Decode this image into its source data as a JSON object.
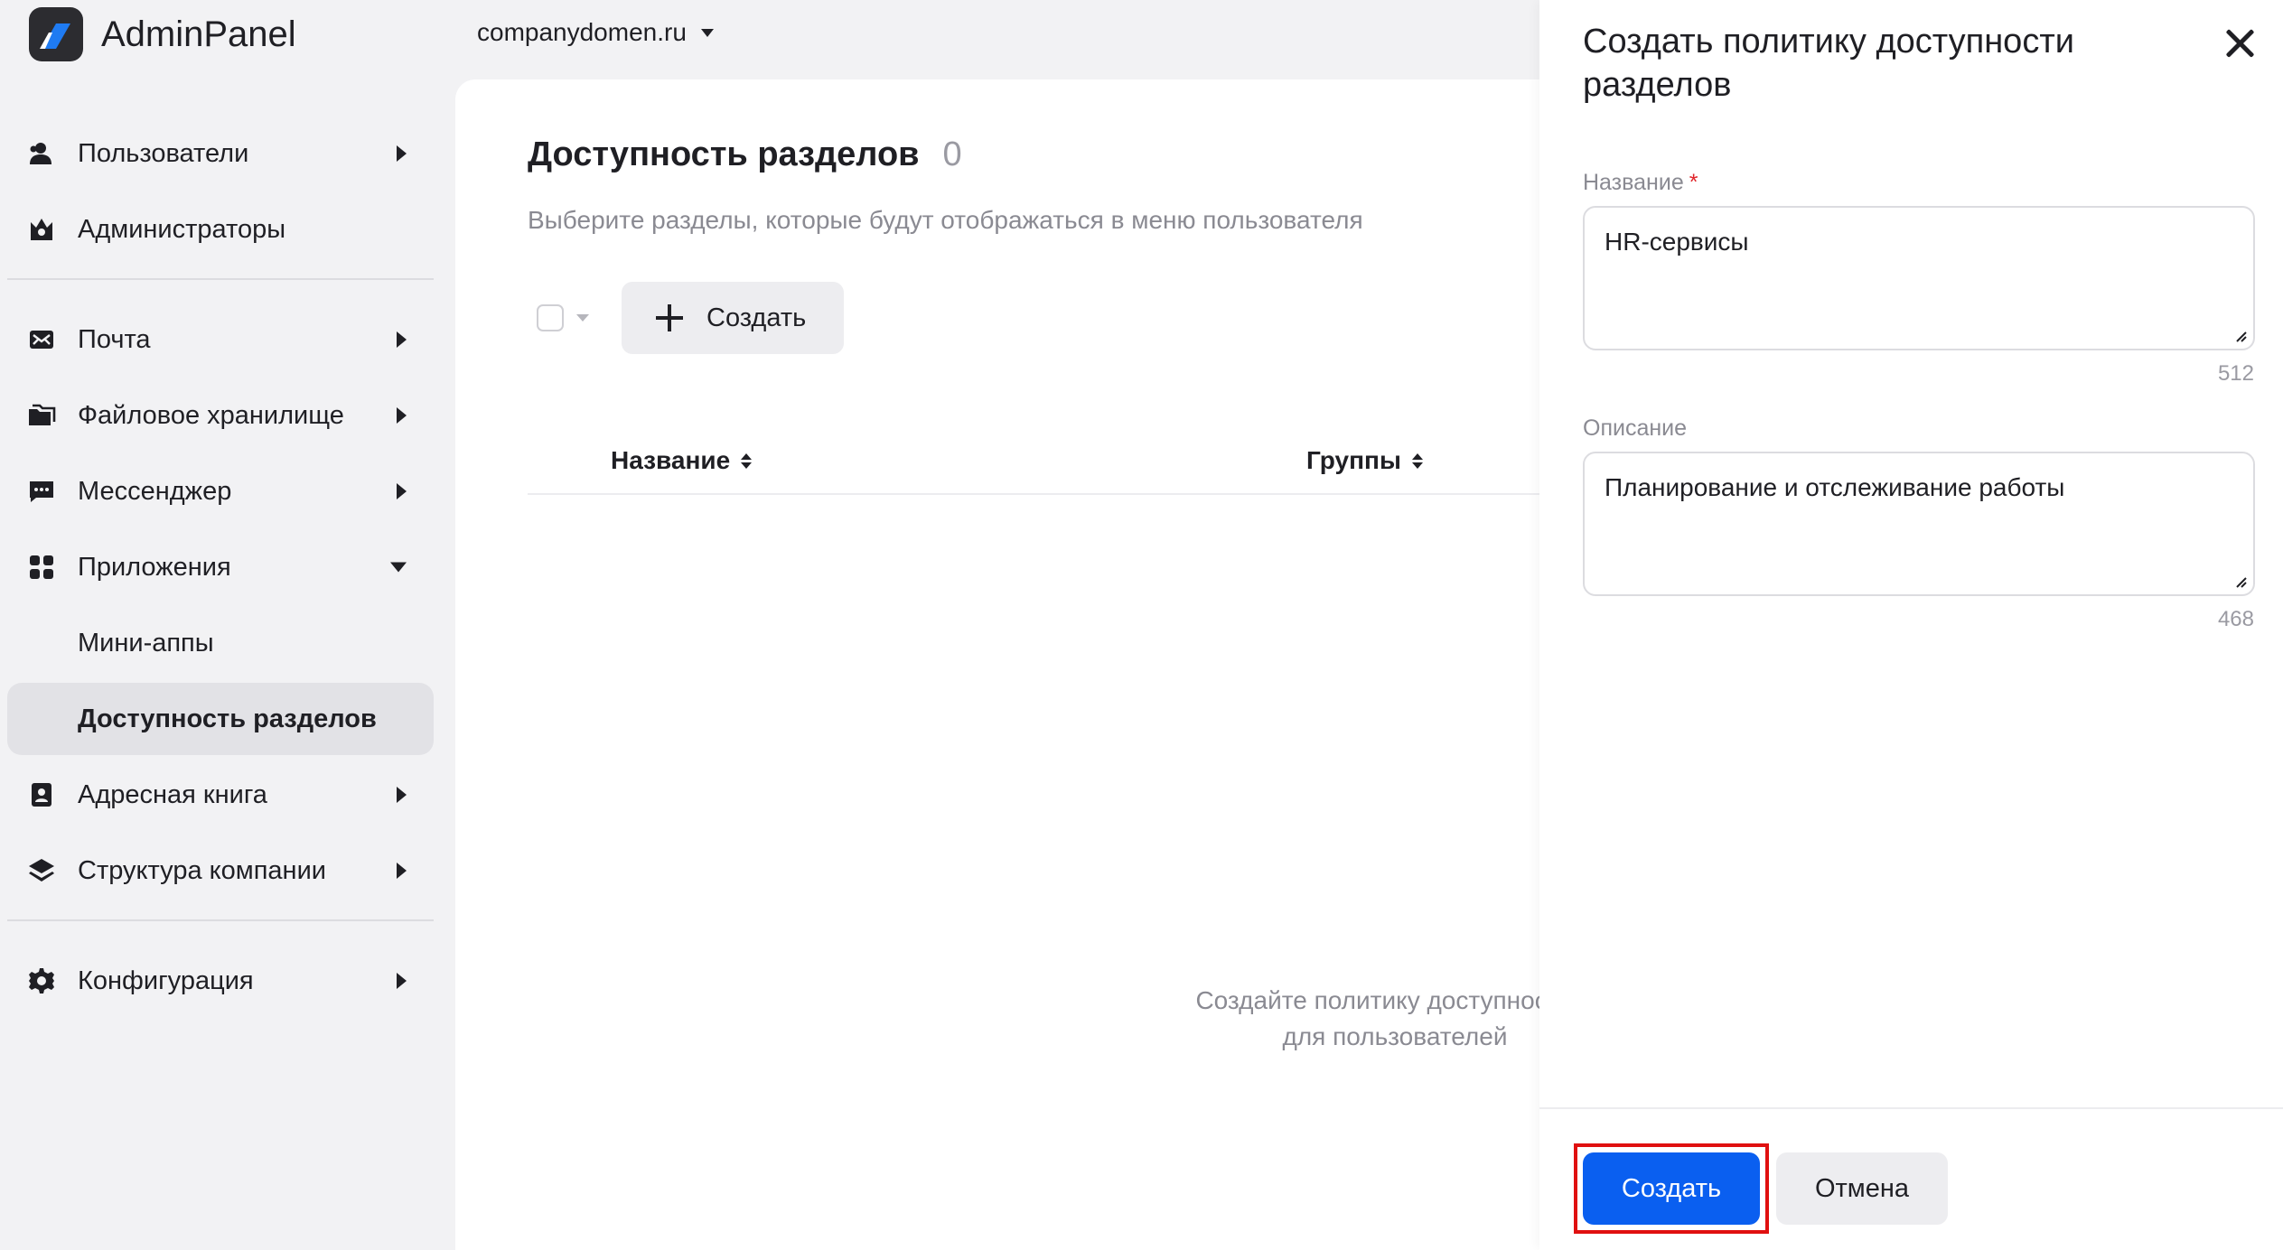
{
  "app": {
    "title": "AdminPanel"
  },
  "domain": {
    "value": "companydomen.ru"
  },
  "sidebar": {
    "items": [
      {
        "label": "Пользователи",
        "icon": "users-icon",
        "expand": "right"
      },
      {
        "label": "Администраторы",
        "icon": "admin-crown-icon",
        "expand": "none"
      },
      {
        "label": "Почта",
        "icon": "mail-icon",
        "expand": "right"
      },
      {
        "label": "Файловое хранилище",
        "icon": "folder-icon",
        "expand": "right"
      },
      {
        "label": "Мессенджер",
        "icon": "chat-icon",
        "expand": "right"
      },
      {
        "label": "Приложения",
        "icon": "apps-grid-icon",
        "expand": "down"
      },
      {
        "label": "Мини-аппы",
        "icon": "",
        "expand": "none"
      },
      {
        "label": "Доступность разделов",
        "icon": "",
        "expand": "none",
        "active": true
      },
      {
        "label": "Адресная книга",
        "icon": "address-book-icon",
        "expand": "right"
      },
      {
        "label": "Структура компании",
        "icon": "layers-icon",
        "expand": "right"
      },
      {
        "label": "Конфигурация",
        "icon": "gear-icon",
        "expand": "right"
      }
    ]
  },
  "main": {
    "title": "Доступность разделов",
    "count": "0",
    "subtitle": "Выберите разделы, которые будут отображаться в меню пользователя",
    "create_label": "Создать",
    "columns": [
      "Название",
      "Группы"
    ],
    "empty_line1": "Создайте политику доступности р",
    "empty_line2": "для пользователей"
  },
  "drawer": {
    "title": "Создать политику доступности разделов",
    "name_label": "Название",
    "name_required": "*",
    "name_value": "HR-сервисы",
    "name_counter": "512",
    "desc_label": "Описание",
    "desc_value": "Планирование и отслеживание работы",
    "desc_counter": "468",
    "submit_label": "Создать",
    "cancel_label": "Отмена"
  },
  "colors": {
    "accent": "#0a5ff0",
    "highlight": "#e01010",
    "required": "#e0262b"
  }
}
